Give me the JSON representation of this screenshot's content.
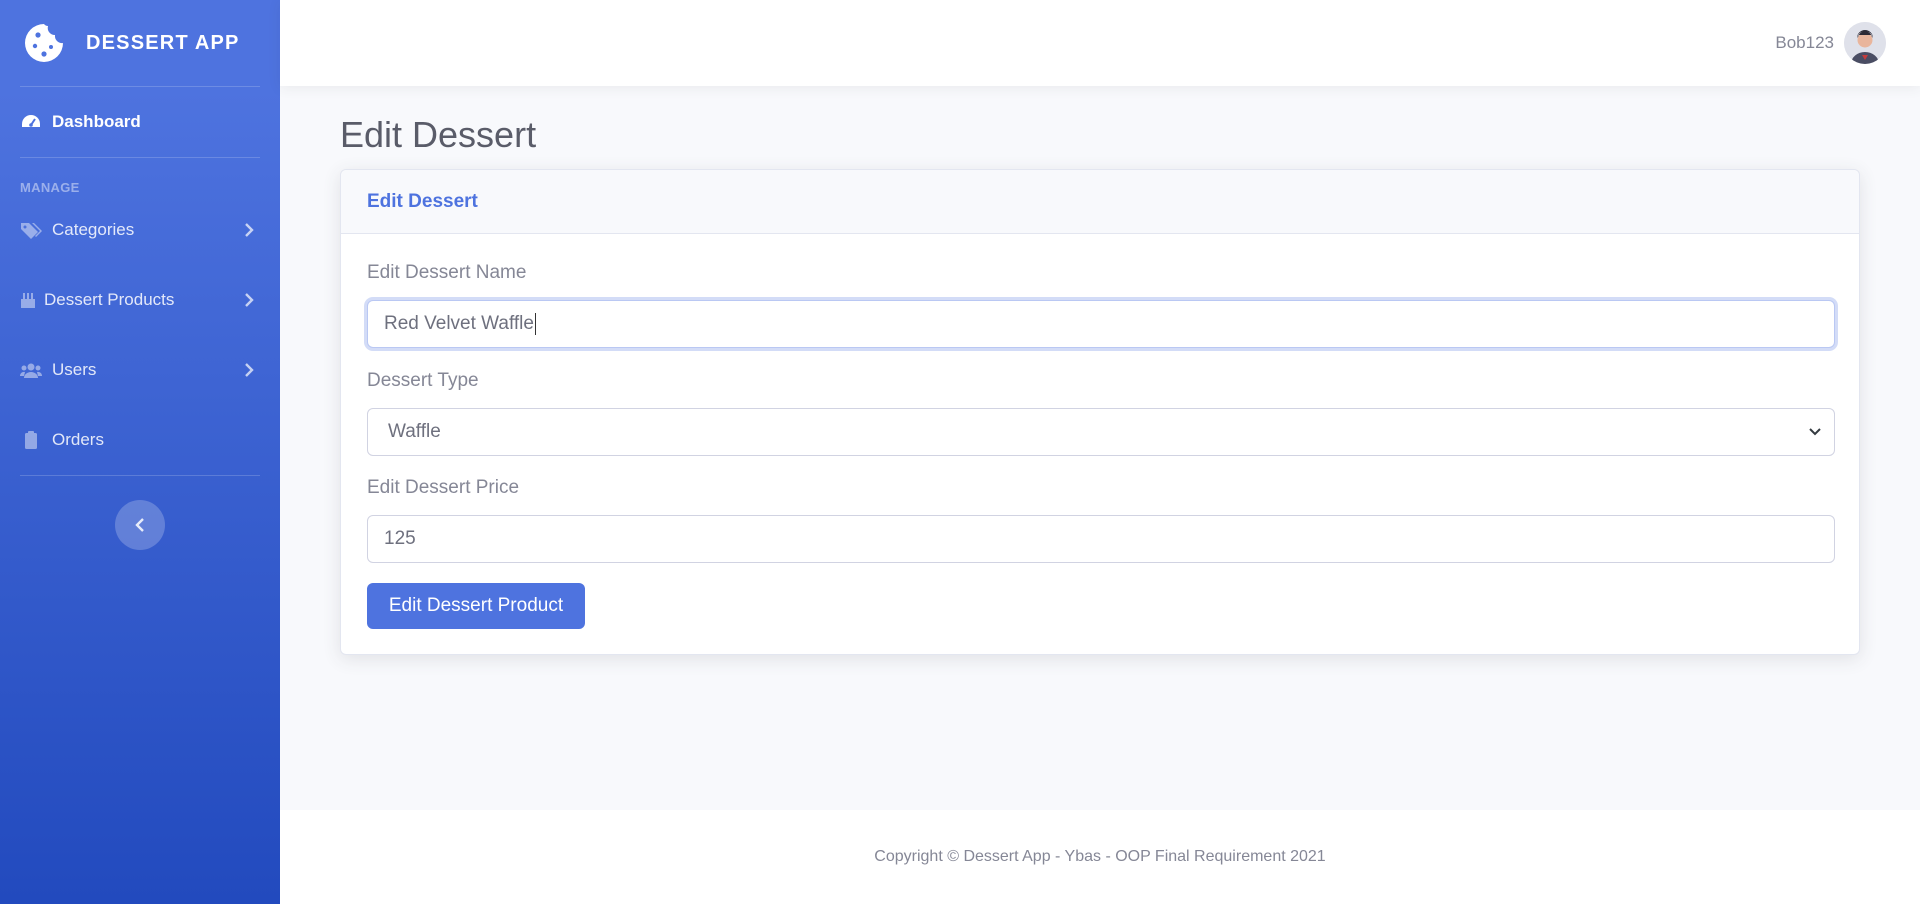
{
  "brand": {
    "name": "DESSERT APP",
    "icon": "cookie-icon"
  },
  "sidebar": {
    "dashboard": {
      "label": "Dashboard",
      "icon": "tachometer-icon"
    },
    "heading": "MANAGE",
    "items": [
      {
        "label": "Categories",
        "icon": "tags-icon"
      },
      {
        "label": "Dessert Products",
        "icon": "birthday-cake-icon"
      },
      {
        "label": "Users",
        "icon": "users-icon"
      },
      {
        "label": "Orders",
        "icon": "clipboard-icon"
      }
    ],
    "toggle_icon": "chevron-left-icon"
  },
  "topbar": {
    "username": "Bob123",
    "avatar_icon": "user-avatar"
  },
  "page": {
    "title": "Edit Dessert"
  },
  "card": {
    "title": "Edit Dessert",
    "name_label": "Edit Dessert Name",
    "name_value": "Red Velvet Waffle",
    "type_label": "Dessert Type",
    "type_value": "Waffle",
    "price_label": "Edit Dessert Price",
    "price_value": "125",
    "submit_label": "Edit Dessert Product"
  },
  "footer": {
    "text": "Copyright © Dessert App - Ybas - OOP Final Requirement 2021"
  },
  "colors": {
    "primary": "#4e73df",
    "primary_dark": "#224abe",
    "text_muted": "#858796",
    "heading": "#5a5c69"
  }
}
